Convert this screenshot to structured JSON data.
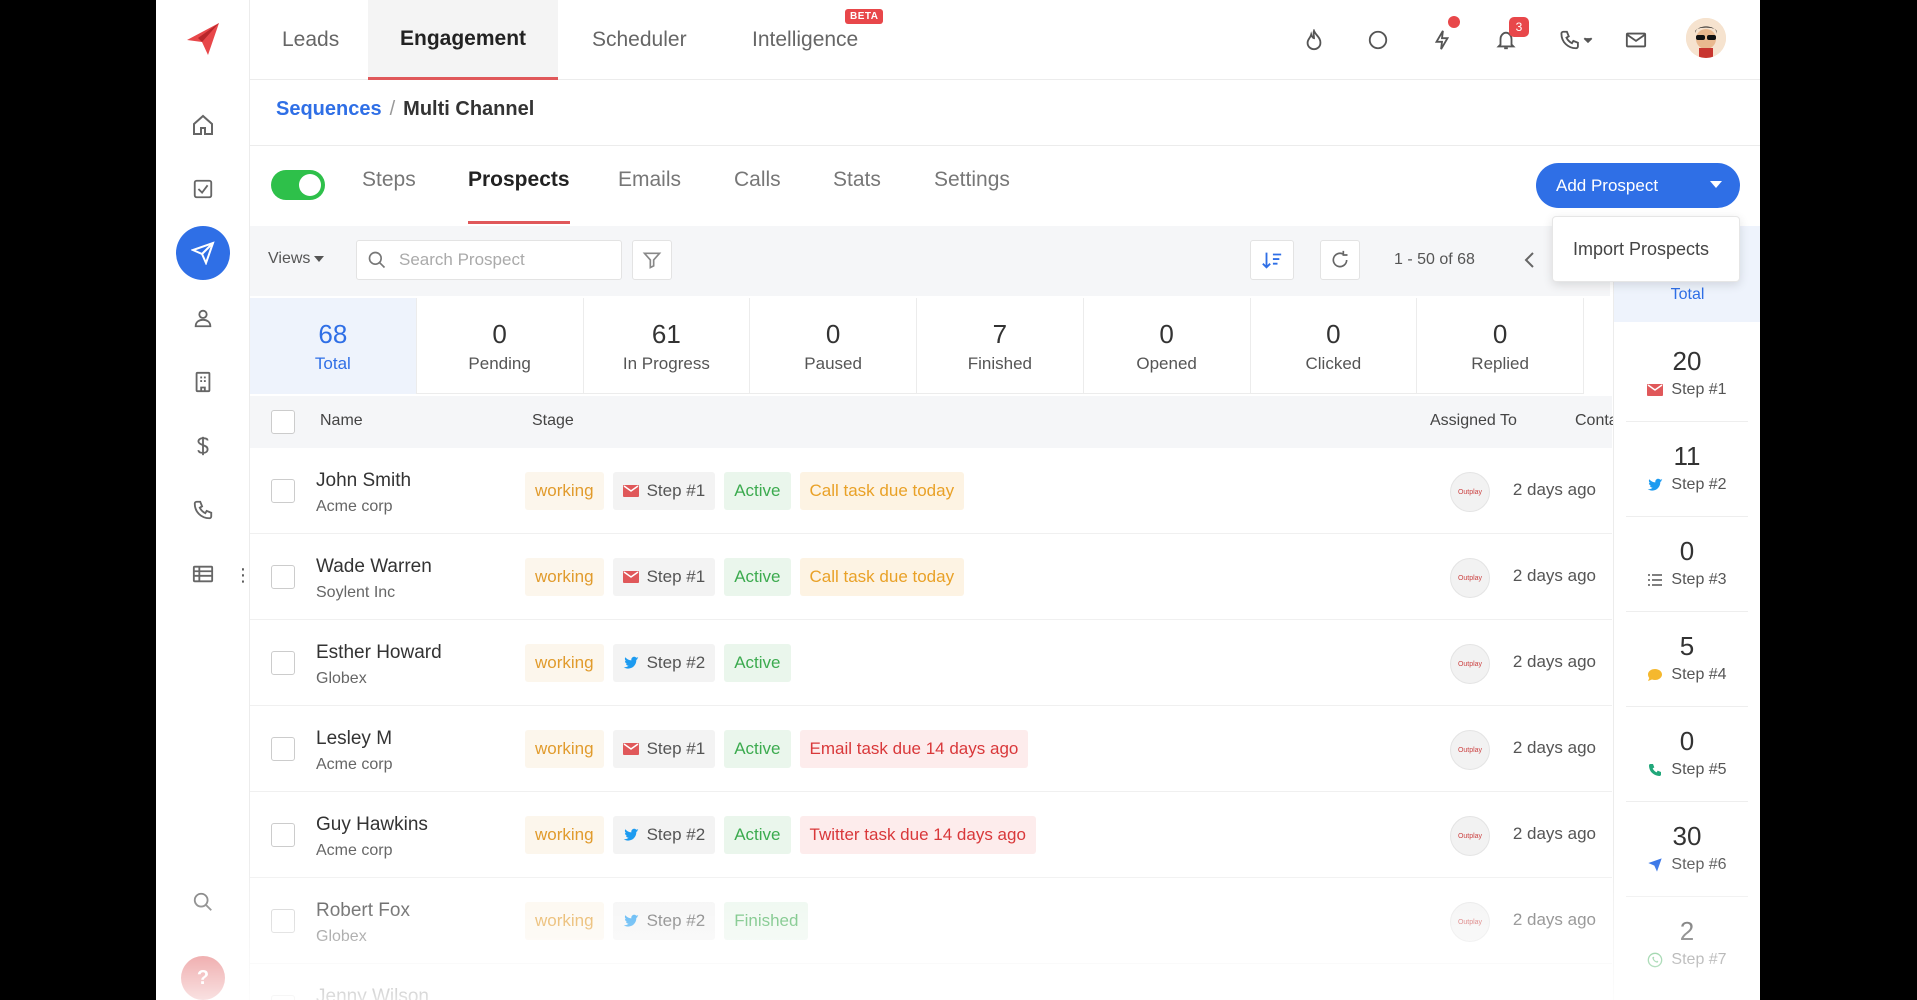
{
  "topnav": {
    "tabs": [
      {
        "label": "Leads"
      },
      {
        "label": "Engagement"
      },
      {
        "label": "Scheduler"
      },
      {
        "label": "Intelligence"
      }
    ],
    "beta_label": "BETA",
    "notifications_count": "3"
  },
  "breadcrumb": {
    "parent": "Sequences",
    "separator": "/",
    "current": "Multi Channel"
  },
  "subtabs": [
    "Steps",
    "Prospects",
    "Emails",
    "Calls",
    "Stats",
    "Settings"
  ],
  "actions": {
    "add_prospect": "Add Prospect",
    "import_prospects": "Import Prospects"
  },
  "toolbar": {
    "views_label": "Views",
    "search_placeholder": "Search Prospect",
    "pager": "1 - 50 of 68"
  },
  "stats": [
    {
      "value": "68",
      "label": "Total"
    },
    {
      "value": "0",
      "label": "Pending"
    },
    {
      "value": "61",
      "label": "In Progress"
    },
    {
      "value": "0",
      "label": "Paused"
    },
    {
      "value": "7",
      "label": "Finished"
    },
    {
      "value": "0",
      "label": "Opened"
    },
    {
      "value": "0",
      "label": "Clicked"
    },
    {
      "value": "0",
      "label": "Replied"
    }
  ],
  "table": {
    "headers": {
      "name": "Name",
      "stage": "Stage",
      "assigned": "Assigned To",
      "contacted": "Contacted Date"
    },
    "assignee_logo": "Outplay",
    "rows": [
      {
        "name": "John Smith",
        "company": "Acme corp",
        "stage": "working",
        "step": "Step #1",
        "status": "Active",
        "task": "Call task due today",
        "date": "2 days ago"
      },
      {
        "name": "Wade Warren",
        "company": "Soylent Inc",
        "stage": "working",
        "step": "Step #1",
        "status": "Active",
        "task": "Call task due today",
        "date": "2 days ago"
      },
      {
        "name": "Esther Howard",
        "company": "Globex",
        "stage": "working",
        "step": "Step #2",
        "status": "Active",
        "task": "",
        "date": "2 days ago"
      },
      {
        "name": "Lesley M",
        "company": "Acme corp",
        "stage": "working",
        "step": "Step #1",
        "status": "Active",
        "task": "Email task due 14 days ago",
        "date": "2 days ago"
      },
      {
        "name": "Guy Hawkins",
        "company": "Acme corp",
        "stage": "working",
        "step": "Step #2",
        "status": "Active",
        "task": "Twitter task due 14 days ago",
        "date": "2 days ago"
      },
      {
        "name": "Robert Fox",
        "company": "Globex",
        "stage": "working",
        "step": "Step #2",
        "status": "Finished",
        "task": "",
        "date": "2 days ago"
      },
      {
        "name": "Jenny Wilson",
        "company": "",
        "stage": "",
        "step": "",
        "status": "",
        "task": "",
        "date": ""
      }
    ]
  },
  "step_column": {
    "total_label": "Total",
    "steps": [
      {
        "value": "20",
        "label": "Step #1"
      },
      {
        "value": "11",
        "label": "Step #2"
      },
      {
        "value": "0",
        "label": "Step #3"
      },
      {
        "value": "5",
        "label": "Step #4"
      },
      {
        "value": "0",
        "label": "Step #5"
      },
      {
        "value": "30",
        "label": "Step #6"
      },
      {
        "value": "2",
        "label": "Step #7"
      }
    ]
  },
  "help_label": "?",
  "colors": {
    "brand": "#2f6fe6",
    "accent": "#e0585a",
    "success": "#2ec04a",
    "warning": "#e19b2c",
    "danger": "#d9383a"
  }
}
